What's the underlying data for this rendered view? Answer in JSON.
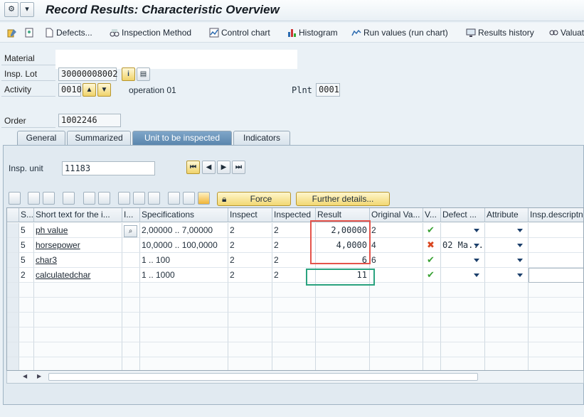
{
  "window": {
    "title": "Record Results: Characteristic Overview"
  },
  "toolbar": {
    "defects": "Defects...",
    "inspection_method": "Inspection Method",
    "control_chart": "Control chart",
    "histogram": "Histogram",
    "run_values": "Run values (run chart)",
    "results_history": "Results history",
    "valuation": "Valuat"
  },
  "header": {
    "material_label": "Material",
    "material_value": "",
    "lot_label": "Insp. Lot",
    "lot_value": "30000008002",
    "activity_label": "Activity",
    "activity_value": "0010",
    "operation_text": "operation 01",
    "plant_label": "Plnt",
    "plant_value": "0001",
    "order_label": "Order",
    "order_value": "1002246"
  },
  "tabs": [
    "General",
    "Summarized",
    "Unit to be inspected",
    "Indicators"
  ],
  "insp_unit": {
    "label": "Insp. unit",
    "value": "11183"
  },
  "buttons": {
    "force": "Force",
    "further_details": "Further details..."
  },
  "table": {
    "columns": [
      "S...",
      "Short text for the i...",
      "I...",
      "Specifications",
      "Inspect",
      "Inspected",
      "Result",
      "Original Va...",
      "V...",
      "Defect ...",
      "Attribute",
      "Insp.descriptn"
    ],
    "rows": [
      {
        "s": "5",
        "text": "ph value",
        "spec": "2,00000 .. 7,00000",
        "inspect": "2",
        "inspected": "2",
        "result": "2,00000",
        "original": "2",
        "valuation": "accept",
        "defect": "",
        "attribute": ""
      },
      {
        "s": "5",
        "text": "horsepower",
        "spec": "10,0000 .. 100,0000",
        "inspect": "2",
        "inspected": "2",
        "result": "4,0000",
        "original": "4",
        "valuation": "reject",
        "defect": "02 Ma...",
        "attribute": ""
      },
      {
        "s": "5",
        "text": "char3",
        "spec": "1 .. 100",
        "inspect": "2",
        "inspected": "2",
        "result": "6",
        "original": "6",
        "valuation": "accept",
        "defect": "",
        "attribute": ""
      },
      {
        "s": "2",
        "text": "calculatedchar",
        "spec": "1 .. 1000",
        "inspect": "2",
        "inspected": "2",
        "result": "11",
        "original": "",
        "valuation": "accept",
        "defect": "",
        "attribute": ""
      }
    ]
  },
  "colors": {
    "accept": "#3aa235",
    "reject": "#d9451f",
    "highlight_red": "#e5534b",
    "highlight_green": "#2aa37f"
  }
}
